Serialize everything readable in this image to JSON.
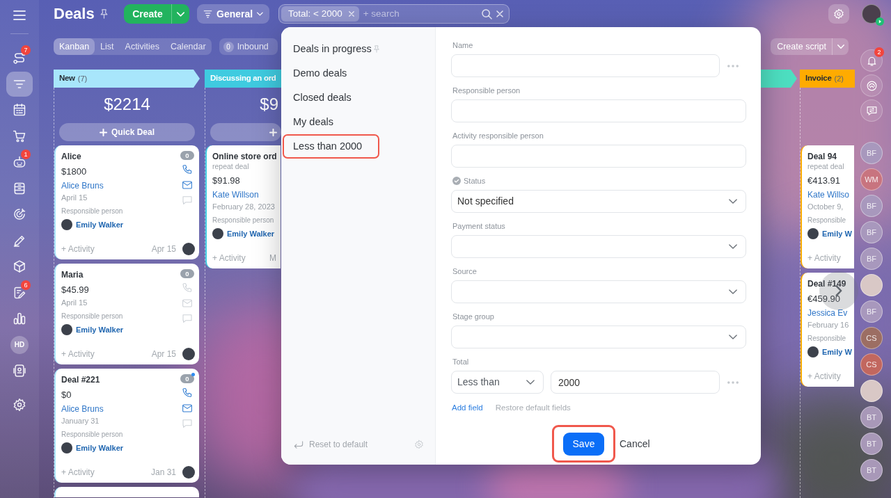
{
  "header": {
    "title": "Deals",
    "create_button": "Create",
    "category_button": "General",
    "search": {
      "chips": [
        {
          "label": "Total: < 2000"
        }
      ],
      "placeholder": "+ search"
    }
  },
  "sidebar": {
    "items": [
      {
        "kind": "icon",
        "badge": "7",
        "selected": false
      },
      {
        "kind": "icon",
        "selected": true
      },
      {
        "kind": "icon",
        "selected": false
      },
      {
        "kind": "icon",
        "selected": false
      },
      {
        "kind": "icon",
        "badge": "1",
        "selected": false
      },
      {
        "kind": "icon",
        "selected": false
      },
      {
        "kind": "icon",
        "selected": false
      },
      {
        "kind": "icon",
        "selected": false
      },
      {
        "kind": "icon",
        "selected": false
      },
      {
        "kind": "icon",
        "badge": "6",
        "selected": false
      },
      {
        "kind": "icon",
        "selected": false
      },
      {
        "kind": "initials",
        "text": "HD",
        "selected": false
      },
      {
        "kind": "icon",
        "selected": false
      }
    ]
  },
  "view_tabs": [
    {
      "label": "Kanban",
      "selected": true
    },
    {
      "label": "List",
      "selected": false
    },
    {
      "label": "Activities",
      "selected": false
    },
    {
      "label": "Calendar",
      "selected": false
    }
  ],
  "inbound": {
    "count": "0",
    "label": "Inbound"
  },
  "script_button": "Create script",
  "columns": [
    {
      "title": "New",
      "count": "(7)",
      "color": "#a8e6fb",
      "total": "$2214",
      "quick_deal": true,
      "quick_deal_label": "Quick Deal",
      "cards": [
        {
          "kind": "full",
          "title": "Alice",
          "count": "0",
          "unread": false,
          "amount": "$1800",
          "contact": "Alice Bruns",
          "date": "April 15",
          "icons": [
            {
              "kind": "phone",
              "active": true
            },
            {
              "kind": "email",
              "active": true
            },
            {
              "kind": "chat",
              "active": false
            }
          ],
          "responsible_label": "Responsible person",
          "responsible": "Emily Walker",
          "activity": "+ Activity",
          "due": "Apr 15"
        },
        {
          "kind": "full",
          "title": "Maria",
          "count": "0",
          "unread": false,
          "amount": "$45.99",
          "date": "April 15",
          "icons": [
            {
              "kind": "phone",
              "active": false
            },
            {
              "kind": "email",
              "active": false
            },
            {
              "kind": "chat",
              "active": false
            }
          ],
          "responsible_label": "Responsible person",
          "responsible": "Emily Walker",
          "activity": "+ Activity",
          "due": "Apr 15"
        },
        {
          "kind": "full",
          "title": "Deal #221",
          "count": "0",
          "unread": true,
          "amount": "$0",
          "contact": "Alice Bruns",
          "date": "January 31",
          "icons": [
            {
              "kind": "phone",
              "active": true
            },
            {
              "kind": "email",
              "active": true
            },
            {
              "kind": "chat",
              "active": false
            }
          ],
          "responsible_label": "Responsible person",
          "responsible": "Emily Walker",
          "activity": "+ Activity",
          "due": "Jan 31"
        },
        {
          "kind": "stub"
        }
      ]
    },
    {
      "title": "Discussing an ord",
      "color": "#3fcbe0",
      "total": "$9",
      "quick_deal": true,
      "cards": [
        {
          "kind": "clipped",
          "title": "Online store ord",
          "subtitle": "repeat deal",
          "amount": "$91.98",
          "contact": "Kate Willson",
          "date": "February 28, 2023",
          "responsible_label": "Responsible person",
          "responsible": "Emily Walker",
          "activity": "+ Activity",
          "due": "M"
        }
      ]
    },
    {
      "color": "#4ddfc1"
    },
    {
      "title": "Invoice",
      "count": "(2)",
      "color": "#ffab00",
      "cards": [
        {
          "kind": "clipped",
          "title": "Deal 94",
          "subtitle": "repeat deal",
          "amount": "€413.91",
          "contact": "Kate Willso",
          "date": "October 9,",
          "responsible_label": "Responsible",
          "responsible": "Emily W",
          "activity": "+ Activity"
        },
        {
          "kind": "clipped",
          "title": "Deal #149",
          "amount": "€459.90",
          "contact": "Jessica Ev",
          "date": "February 16",
          "responsible_label": "Responsible",
          "responsible": "Emily W",
          "activity": "+ Activity"
        }
      ]
    }
  ],
  "filter_dialog": {
    "presets": [
      {
        "label": "Deals in progress",
        "pinned": true,
        "highlighted": false
      },
      {
        "label": "Demo deals",
        "pinned": false,
        "highlighted": false
      },
      {
        "label": "Closed deals",
        "pinned": false,
        "highlighted": false
      },
      {
        "label": "My deals",
        "pinned": false,
        "highlighted": false
      },
      {
        "label": "Less than 2000",
        "pinned": false,
        "highlighted": true
      }
    ],
    "reset_button": "Reset to default",
    "fields": [
      {
        "label": "Name",
        "kind": "text",
        "marked": false,
        "menu": true
      },
      {
        "label": "Responsible person",
        "kind": "text",
        "marked": false,
        "menu": false
      },
      {
        "label": "Activity responsible person",
        "kind": "text",
        "marked": false,
        "menu": false
      },
      {
        "label": "Status",
        "kind": "select",
        "value": "Not specified",
        "marked": true,
        "menu": false
      },
      {
        "label": "Payment status",
        "kind": "select",
        "marked": false,
        "menu": false
      },
      {
        "label": "Source",
        "kind": "select",
        "marked": false,
        "menu": false
      },
      {
        "label": "Stage group",
        "kind": "select",
        "marked": false,
        "menu": false
      },
      {
        "label": "Total",
        "kind": "range",
        "operator": "Less than",
        "value": "2000",
        "marked": false,
        "menu": true
      }
    ],
    "add_field": "Add field",
    "restore_fields": "Restore default fields",
    "save_button": {
      "label": "Save",
      "highlighted": true
    },
    "cancel_button": "Cancel"
  },
  "right_rail": {
    "tools": [
      {
        "kind": "bell",
        "badge": "2"
      },
      {
        "kind": "arcs"
      },
      {
        "kind": "chat"
      }
    ],
    "contacts": [
      {
        "kind": "initials",
        "text": "BF",
        "color": "#a898bd"
      },
      {
        "kind": "initials",
        "text": "WM",
        "color": "#c8747f"
      },
      {
        "kind": "initials",
        "text": "BF",
        "color": "#a898bd"
      },
      {
        "kind": "initials",
        "text": "BF",
        "color": "#a898bd"
      },
      {
        "kind": "initials",
        "text": "BF",
        "color": "#a898bd"
      },
      {
        "kind": "photo"
      },
      {
        "kind": "initials",
        "text": "BF",
        "color": "#a898bd"
      },
      {
        "kind": "initials",
        "text": "CS",
        "color": "#9c6e63"
      },
      {
        "kind": "initials",
        "text": "CS",
        "color": "#c2675f"
      },
      {
        "kind": "photo"
      },
      {
        "kind": "initials",
        "text": "BT",
        "color": "#a898b8"
      },
      {
        "kind": "initials",
        "text": "BT",
        "color": "#a898b8"
      },
      {
        "kind": "initials",
        "text": "BT",
        "color": "#a898b8"
      }
    ]
  }
}
